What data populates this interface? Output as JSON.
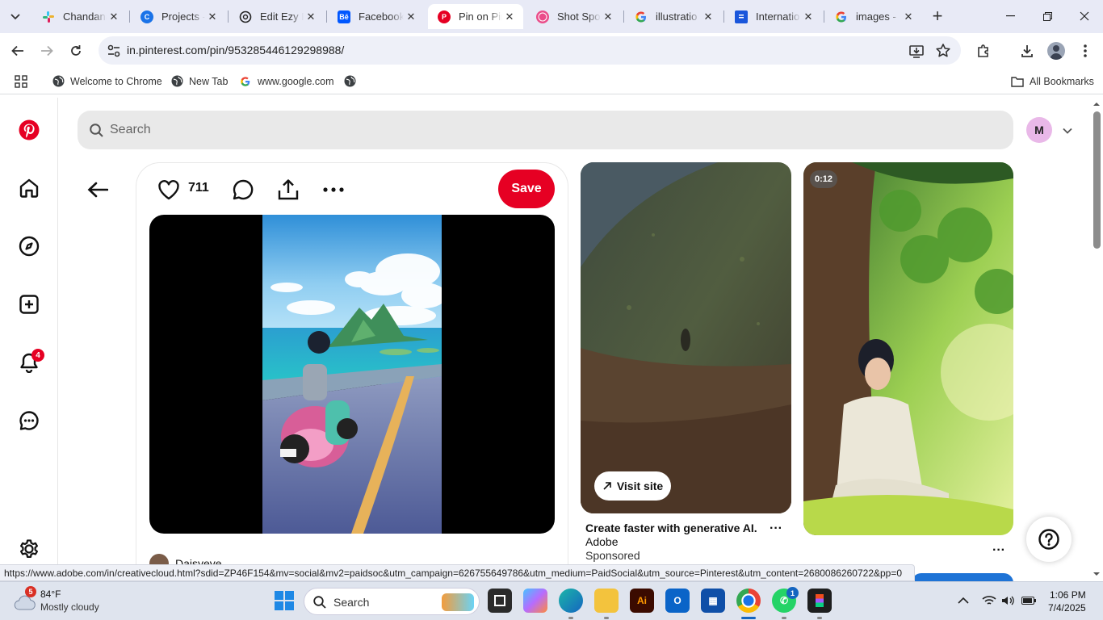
{
  "browser": {
    "tabs": [
      {
        "title": "Chandana",
        "favicon_color": "#611f69"
      },
      {
        "title": "Projects - ",
        "favicon_color": "#1a73e8"
      },
      {
        "title": "Edit Ezy P",
        "favicon_color": "#222222"
      },
      {
        "title": "Facebook",
        "favicon_color": "#0057ff",
        "favicon_text": "Bē"
      },
      {
        "title": "Pin on Pin",
        "favicon_color": "#e60023"
      },
      {
        "title": "Shot Spor",
        "favicon_color": "#ea4c89"
      },
      {
        "title": "illustratio",
        "favicon_color": "#4285f4"
      },
      {
        "title": "Internatio",
        "favicon_color": "#1a56db"
      },
      {
        "title": "images - ",
        "favicon_color": "#4285f4"
      }
    ],
    "active_tab_index": 4,
    "url": "in.pinterest.com/pin/953285446129298988/",
    "bookmarks": [
      {
        "label": "Welcome to Chrome",
        "icon": "globe-icon"
      },
      {
        "label": "New Tab",
        "icon": "globe-icon"
      },
      {
        "label": "www.google.com",
        "icon": "google-icon"
      }
    ],
    "all_bookmarks_label": "All Bookmarks"
  },
  "pinterest": {
    "brand_color": "#e60023",
    "search_placeholder": "Search",
    "avatar_initial": "M",
    "notification_count": "4",
    "pin": {
      "like_count": "711",
      "save_label": "Save",
      "creator": "Daisyeye"
    },
    "ad_pin": {
      "visit_label": "Visit site",
      "title": "Create faster with generative AI.",
      "brand": "Adobe",
      "sponsored": "Sponsored",
      "more_label": "···"
    },
    "video_pin": {
      "duration": "0:12",
      "more_label": "···"
    }
  },
  "status_bar": {
    "link": "https://www.adobe.com/in/creativecloud.html?sdid=ZP46F154&mv=social&mv2=paidsoc&utm_campaign=626755649786&utm_medium=PaidSocial&utm_source=Pinterest&utm_content=2680086260722&pp=0"
  },
  "taskbar": {
    "weather_temp": "84°F",
    "weather_condition": "Mostly cloudy",
    "weather_badge": "5",
    "search_placeholder": "Search",
    "whatsapp_badge": "1",
    "time": "1:06 PM",
    "date": "7/4/2025"
  }
}
